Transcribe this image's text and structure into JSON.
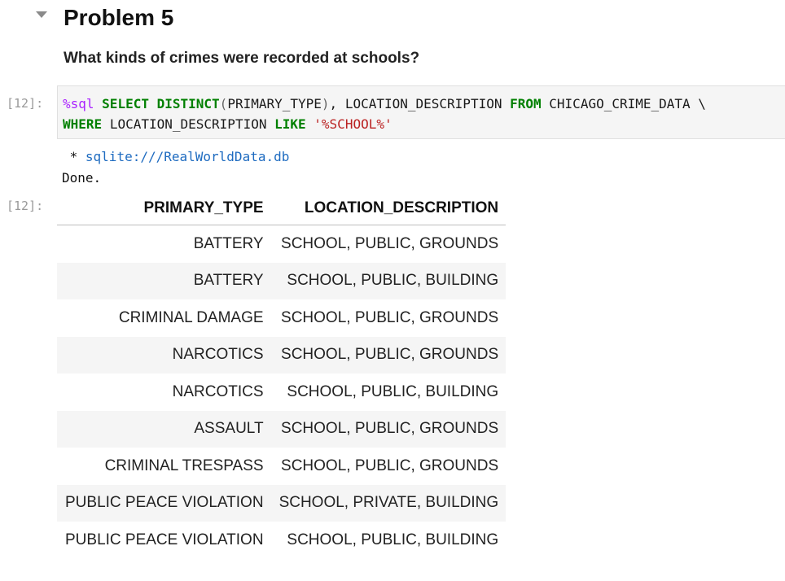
{
  "heading": "Problem 5",
  "question": "What kinds of crimes were recorded at schools?",
  "cell": {
    "in_prompt": "[12]:",
    "out_prompt": "[12]:",
    "code": {
      "magic": "%sql",
      "kw_select": "SELECT",
      "kw_distinct": "DISTINCT",
      "paren_open": "(",
      "col1": "PRIMARY_TYPE",
      "paren_close": ")",
      "comma_col2": ", LOCATION_DESCRIPTION",
      "kw_from": "FROM",
      "table_cont": "CHICAGO_CRIME_DATA \\",
      "kw_where": "WHERE",
      "col_where": "LOCATION_DESCRIPTION",
      "kw_like": "LIKE",
      "pattern": "'%SCHOOL%'"
    }
  },
  "output": {
    "conn_prefix": " * ",
    "conn_link": "sqlite:///RealWorldData.db",
    "done": "Done."
  },
  "table": {
    "columns": [
      "PRIMARY_TYPE",
      "LOCATION_DESCRIPTION"
    ],
    "rows": [
      [
        "BATTERY",
        "SCHOOL, PUBLIC, GROUNDS"
      ],
      [
        "BATTERY",
        "SCHOOL, PUBLIC, BUILDING"
      ],
      [
        "CRIMINAL DAMAGE",
        "SCHOOL, PUBLIC, GROUNDS"
      ],
      [
        "NARCOTICS",
        "SCHOOL, PUBLIC, GROUNDS"
      ],
      [
        "NARCOTICS",
        "SCHOOL, PUBLIC, BUILDING"
      ],
      [
        "ASSAULT",
        "SCHOOL, PUBLIC, GROUNDS"
      ],
      [
        "CRIMINAL TRESPASS",
        "SCHOOL, PUBLIC, GROUNDS"
      ],
      [
        "PUBLIC PEACE VIOLATION",
        "SCHOOL, PRIVATE, BUILDING"
      ],
      [
        "PUBLIC PEACE VIOLATION",
        "SCHOOL, PUBLIC, BUILDING"
      ]
    ]
  }
}
